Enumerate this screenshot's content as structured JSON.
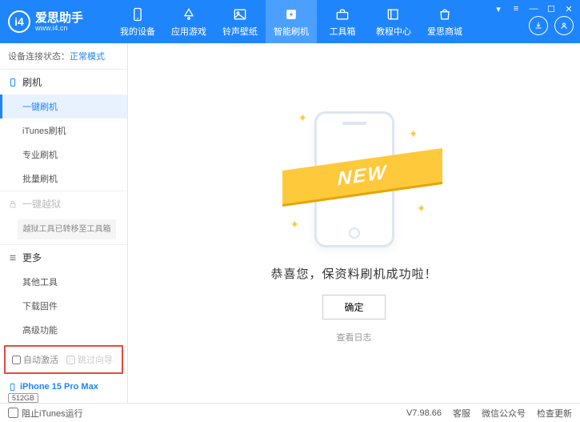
{
  "header": {
    "logo_text": "爱思助手",
    "logo_sub": "www.i4.cn",
    "nav": [
      {
        "label": "我的设备"
      },
      {
        "label": "应用游戏"
      },
      {
        "label": "铃声壁纸"
      },
      {
        "label": "智能刷机"
      },
      {
        "label": "工具箱"
      },
      {
        "label": "教程中心"
      },
      {
        "label": "爱思商城"
      }
    ]
  },
  "sidebar": {
    "status_label": "设备连接状态：",
    "status_value": "正常模式",
    "group_flash": "刷机",
    "flash_items": [
      "一键刷机",
      "iTunes刷机",
      "专业刷机",
      "批量刷机"
    ],
    "group_jailbreak": "一键越狱",
    "jailbreak_note": "越狱工具已转移至工具箱",
    "group_more": "更多",
    "more_items": [
      "其他工具",
      "下载固件",
      "高级功能"
    ],
    "checkbox_auto": "自动激活",
    "checkbox_skip": "跳过向导",
    "device_name": "iPhone 15 Pro Max",
    "device_storage": "512GB",
    "device_type": "iPhone"
  },
  "main": {
    "ribbon": "NEW",
    "success": "恭喜您，保资料刷机成功啦！",
    "confirm": "确定",
    "view_log": "查看日志"
  },
  "footer": {
    "block_itunes": "阻止iTunes运行",
    "version": "V7.98.66",
    "links": [
      "客服",
      "微信公众号",
      "检查更新"
    ]
  }
}
